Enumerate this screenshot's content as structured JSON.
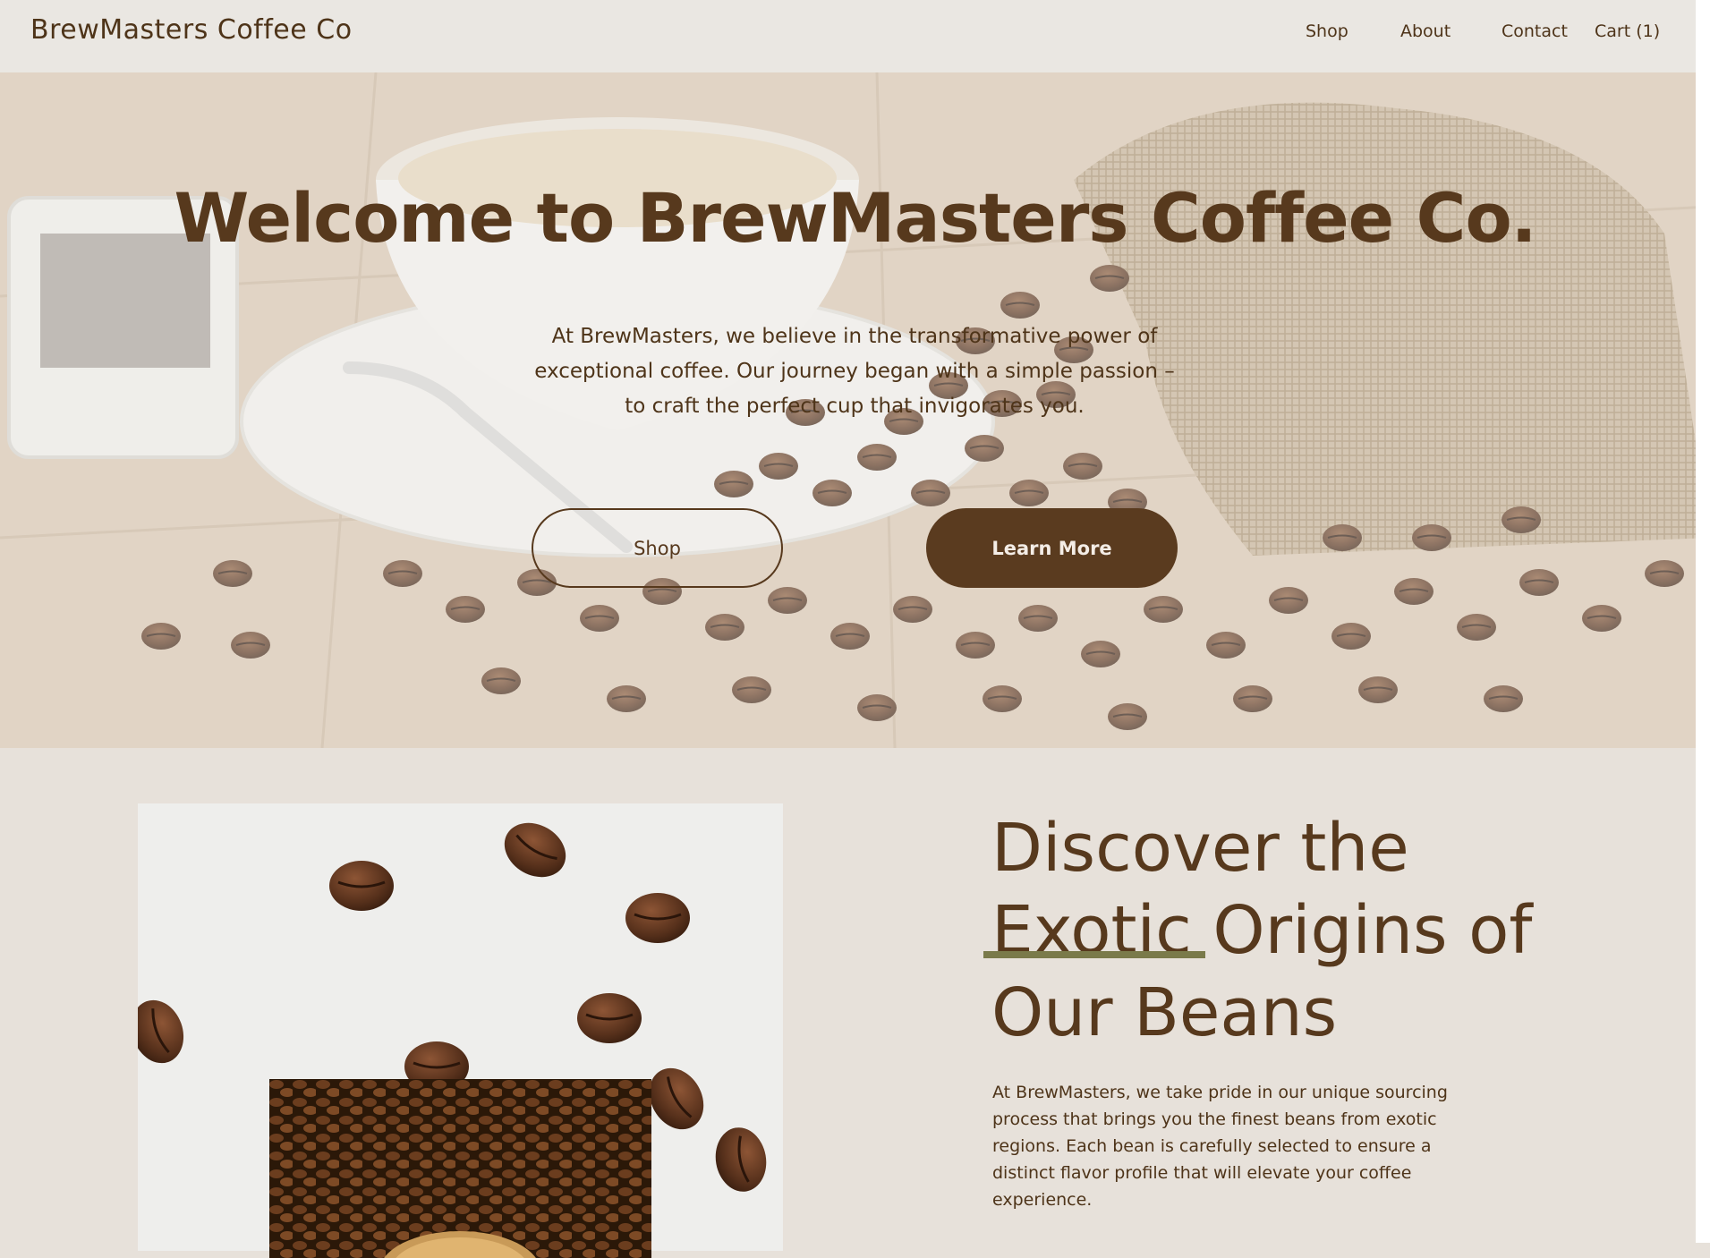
{
  "header": {
    "brand": "BrewMasters Coffee Co",
    "nav": {
      "shop": "Shop",
      "about": "About",
      "contact": "Contact",
      "cart": "Cart (1)"
    }
  },
  "hero": {
    "title": "Welcome to BrewMasters Coffee Co.",
    "text": "At BrewMasters, we believe in the transformative power of exceptional coffee. Our journey began with a simple passion – to craft the perfect cup that invigorates you.",
    "shop_button": "Shop",
    "learn_more_button": "Learn More"
  },
  "origins": {
    "title": "Discover the Exotic Origins of Our Beans",
    "text": "At BrewMasters, we take pride in our unique sourcing process that brings you the finest beans from exotic regions. Each bean is carefully selected to ensure a distinct flavor profile that will elevate your coffee experience."
  },
  "colors": {
    "brand_brown": "#57391d",
    "button_dark": "#5a3b1f",
    "page_background": "#e7e1da",
    "header_background": "#eae7e2",
    "accent_underline": "#7a7a4a"
  }
}
